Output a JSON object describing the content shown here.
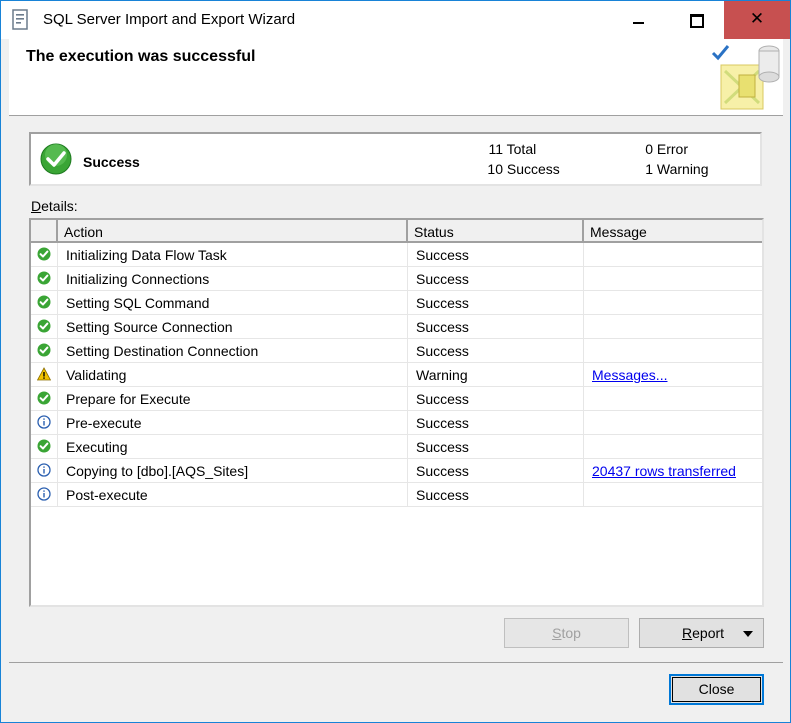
{
  "window": {
    "title": "SQL Server Import and Export Wizard"
  },
  "header": {
    "heading": "The execution was successful"
  },
  "summary": {
    "status": "Success",
    "total_count": "11",
    "total_label": "Total",
    "success_count": "10",
    "success_label": "Success",
    "error_count": "0",
    "error_label": "Error",
    "warning_count": "1",
    "warning_label": "Warning"
  },
  "details": {
    "label_rest": "etails:",
    "label_accel": "D",
    "columns": {
      "action": "Action",
      "status": "Status",
      "message": "Message"
    },
    "rows": [
      {
        "icon": "success-icon",
        "action": "Initializing Data Flow Task",
        "status": "Success",
        "message": ""
      },
      {
        "icon": "success-icon",
        "action": "Initializing Connections",
        "status": "Success",
        "message": ""
      },
      {
        "icon": "success-icon",
        "action": "Setting SQL Command",
        "status": "Success",
        "message": ""
      },
      {
        "icon": "success-icon",
        "action": "Setting Source Connection",
        "status": "Success",
        "message": ""
      },
      {
        "icon": "success-icon",
        "action": "Setting Destination Connection",
        "status": "Success",
        "message": ""
      },
      {
        "icon": "warning-icon",
        "action": "Validating",
        "status": "Warning",
        "message": "Messages..."
      },
      {
        "icon": "success-icon",
        "action": "Prepare for Execute",
        "status": "Success",
        "message": ""
      },
      {
        "icon": "info-icon",
        "action": "Pre-execute",
        "status": "Success",
        "message": ""
      },
      {
        "icon": "success-icon",
        "action": "Executing",
        "status": "Success",
        "message": ""
      },
      {
        "icon": "info-icon",
        "action": "Copying to [dbo].[AQS_Sites]",
        "status": "Success",
        "message": "20437 rows transferred"
      },
      {
        "icon": "info-icon",
        "action": "Post-execute",
        "status": "Success",
        "message": ""
      }
    ]
  },
  "buttons": {
    "stop_accel": "S",
    "stop_rest": "top",
    "report_accel": "R",
    "report_rest": "eport",
    "close": "Close"
  },
  "colors": {
    "accent": "#0078d7",
    "success": "#3aa535",
    "warning": "#f2c200",
    "info": "#2a5fb0",
    "link": "#0000ee"
  }
}
